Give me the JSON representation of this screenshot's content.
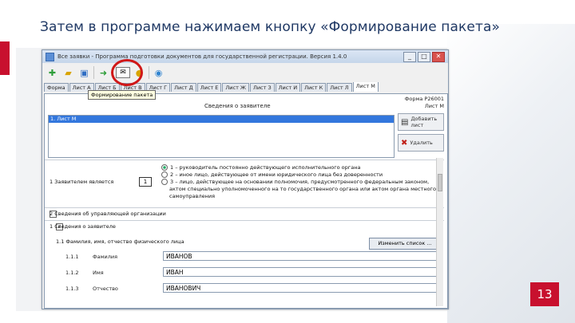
{
  "slide": {
    "title": "Затем в программе нажимаем кнопку «Формирование пакета»",
    "page_number": "13",
    "accent_color": "#c8102e"
  },
  "window": {
    "title": "Все заявки - Программа подготовки документов для государственной регистрации. Версия 1.4.0",
    "buttons": [
      "_",
      "□",
      "✕"
    ]
  },
  "toolbar": {
    "tooltip": "Формирование пакета",
    "icons": [
      "new-icon",
      "open-icon",
      "save-icon",
      "export-icon",
      "envelope-icon",
      "help-icon"
    ]
  },
  "tabs": [
    "Форма",
    "Лист А",
    "Лист Б",
    "Лист В",
    "Лист Г",
    "Лист Д",
    "Лист Е",
    "Лист Ж",
    "Лист З",
    "Лист И",
    "Лист К",
    "Лист Л",
    "Лист М"
  ],
  "form": {
    "code_line1": "Форма Р26001",
    "code_line2": "Лист М",
    "section_title": "Сведения о заявителе",
    "list_item": "1. Лист М",
    "add_button": "Добавить лист",
    "delete_button": "Удалить",
    "applicant_label": "1  Заявителем является",
    "applicant_value": "1",
    "radio_options": [
      "1 – руководитель постоянно действующего исполнительного органа",
      "2 – иное лицо, действующее от имени юридического лица без доверенности",
      "3 – лицо, действующее на основании полномочия, предусмотренного федеральным законом,",
      "актом специально уполномоченного на то государственного органа или актом органа местного",
      "самоуправления"
    ],
    "row2_label": "2   Сведения об управляющей организации",
    "row1_label": "1   Сведения о заявителе",
    "row1_1_label": "1.1    Фамилия, имя, отчество физического лица",
    "select_button": "Изменить список ...",
    "fields": [
      {
        "num": "1.1.1",
        "label": "Фамилия",
        "value": "ИВАНОВ"
      },
      {
        "num": "1.1.2",
        "label": "Имя",
        "value": "ИВАН"
      },
      {
        "num": "1.1.3",
        "label": "Отчество",
        "value": "ИВАНОВИЧ"
      }
    ]
  }
}
